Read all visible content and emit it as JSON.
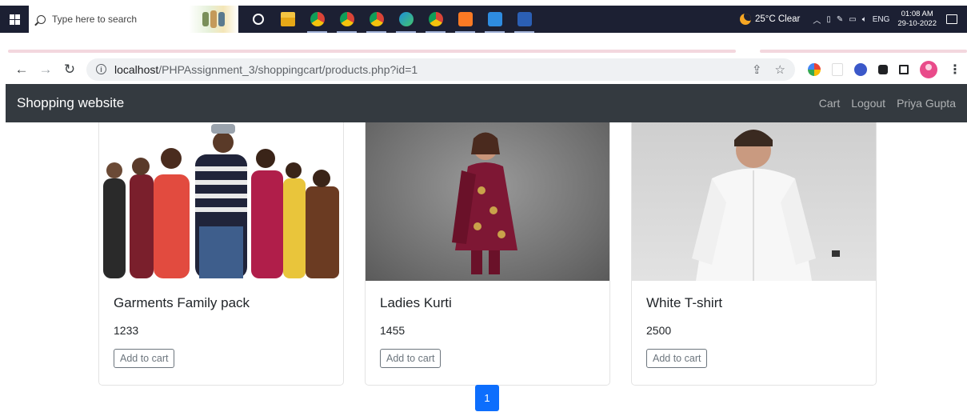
{
  "taskbar": {
    "search_placeholder": "Type here to search",
    "apps": [
      "cortana-icon",
      "file-explorer-icon",
      "chrome-icon",
      "chrome-icon",
      "chrome-icon",
      "edge-icon",
      "chrome-icon",
      "xampp-icon",
      "vscode-icon",
      "word-icon"
    ],
    "weather": "25°C Clear",
    "language": "ENG",
    "time": "01:08 AM",
    "date": "29-10-2022"
  },
  "browser": {
    "url_host": "localhost",
    "url_path": "/PHPAssignment_3/shoppingcart/products.php?id=1"
  },
  "site": {
    "brand": "Shopping website",
    "nav": {
      "cart": "Cart",
      "logout": "Logout",
      "user": "Priya Gupta"
    }
  },
  "products": [
    {
      "title": "Garments Family pack",
      "price": "1233",
      "button": "Add to cart"
    },
    {
      "title": "Ladies Kurti",
      "price": "1455",
      "button": "Add to cart"
    },
    {
      "title": "White T-shirt",
      "price": "2500",
      "button": "Add to cart"
    }
  ],
  "pagination": {
    "current": "1"
  },
  "colors": {
    "navbar": "#343a40",
    "primary": "#0d6efd",
    "taskbar": "#1c2033"
  }
}
